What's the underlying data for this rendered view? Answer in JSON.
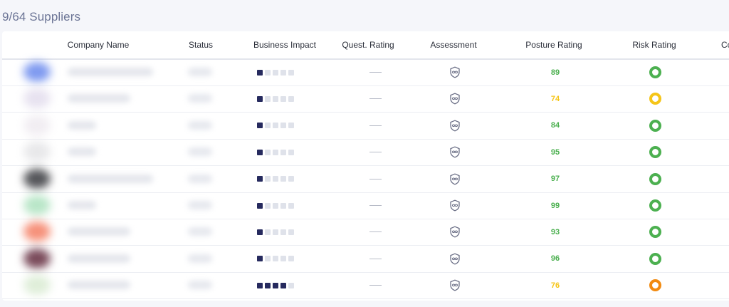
{
  "page_title": "9/64 Suppliers",
  "columns": {
    "company_name": "Company Name",
    "status": "Status",
    "business_impact": "Business Impact",
    "quest_rating": "Quest. Rating",
    "assessment": "Assessment",
    "posture_rating": "Posture Rating",
    "risk_rating": "Risk Rating",
    "cut_off": "Co"
  },
  "colors": {
    "green": "#4cb050",
    "yellow": "#f5c518",
    "orange": "#f28a10",
    "impact_on": "#262a5e",
    "impact_off": "#dfe2ea"
  },
  "rows": [
    {
      "logo_color": "#7f9af0",
      "name_width": "wide",
      "business_impact": 1,
      "quest_rating": "—",
      "assessment_icon": "shield-mask-icon",
      "posture_rating": "89",
      "posture_color": "green",
      "risk": "green"
    },
    {
      "logo_color": "#e7e2f0",
      "name_width": "medium",
      "business_impact": 1,
      "quest_rating": "—",
      "assessment_icon": "shield-mask-icon",
      "posture_rating": "74",
      "posture_color": "yellow",
      "risk": "yellow"
    },
    {
      "logo_color": "#f1edf2",
      "name_width": "short",
      "business_impact": 1,
      "quest_rating": "—",
      "assessment_icon": "shield-mask-icon",
      "posture_rating": "84",
      "posture_color": "green",
      "risk": "green"
    },
    {
      "logo_color": "#e8e8ea",
      "name_width": "short",
      "business_impact": 1,
      "quest_rating": "—",
      "assessment_icon": "shield-mask-icon",
      "posture_rating": "95",
      "posture_color": "green",
      "risk": "green"
    },
    {
      "logo_color": "#55565a",
      "name_width": "wide",
      "business_impact": 1,
      "quest_rating": "—",
      "assessment_icon": "shield-mask-icon",
      "posture_rating": "97",
      "posture_color": "green",
      "risk": "green"
    },
    {
      "logo_color": "#b9e6c8",
      "name_width": "short",
      "business_impact": 1,
      "quest_rating": "—",
      "assessment_icon": "shield-mask-icon",
      "posture_rating": "99",
      "posture_color": "green",
      "risk": "green"
    },
    {
      "logo_color": "#f6917a",
      "name_width": "medium",
      "business_impact": 1,
      "quest_rating": "—",
      "assessment_icon": "shield-mask-icon",
      "posture_rating": "93",
      "posture_color": "green",
      "risk": "green"
    },
    {
      "logo_color": "#7a4a5a",
      "name_width": "medium",
      "business_impact": 1,
      "quest_rating": "—",
      "assessment_icon": "shield-mask-icon",
      "posture_rating": "96",
      "posture_color": "green",
      "risk": "green"
    },
    {
      "logo_color": "#dfeed9",
      "name_width": "medium",
      "business_impact": 4,
      "quest_rating": "—",
      "assessment_icon": "shield-mask-icon",
      "posture_rating": "76",
      "posture_color": "yellow",
      "risk": "orange"
    }
  ]
}
